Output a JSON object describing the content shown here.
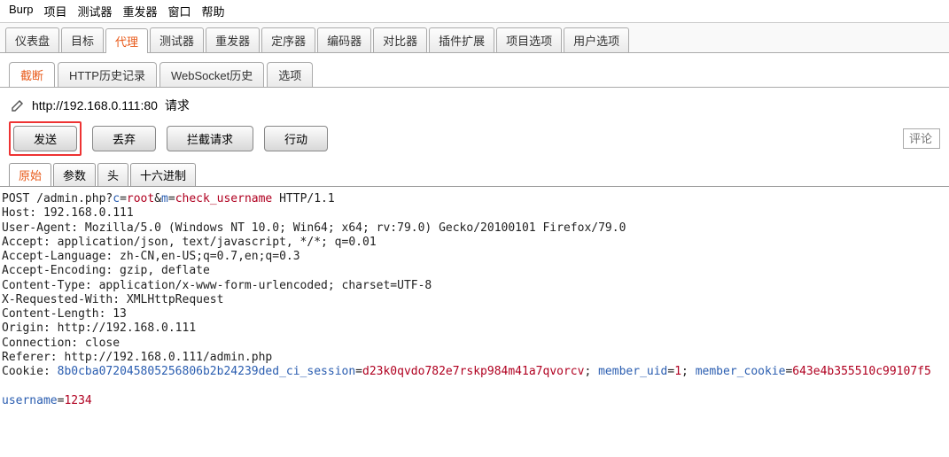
{
  "menubar": {
    "burp": "Burp",
    "project": "项目",
    "intruder": "测试器",
    "repeater": "重发器",
    "window": "窗口",
    "help": "帮助"
  },
  "main_tabs": {
    "dashboard": "仪表盘",
    "target": "目标",
    "proxy": "代理",
    "intruder": "测试器",
    "repeater": "重发器",
    "sequencer": "定序器",
    "decoder": "编码器",
    "comparer": "对比器",
    "extender": "插件扩展",
    "project_options": "项目选项",
    "user_options": "用户选项"
  },
  "sub_tabs": {
    "intercept": "截断",
    "http_history": "HTTP历史记录",
    "ws_history": "WebSocket历史",
    "options": "选项"
  },
  "request_line": {
    "url": "http://192.168.0.111:80",
    "label": "请求"
  },
  "buttons": {
    "forward": "发送",
    "drop": "丢弃",
    "intercept": "拦截请求",
    "action": "行动"
  },
  "comment_placeholder": "评论",
  "view_tabs": {
    "raw": "原始",
    "params": "参数",
    "headers": "头",
    "hex": "十六进制"
  },
  "raw_request": {
    "line1_pre": "POST /admin.php?",
    "line1_p1": "c",
    "line1_eq1": "=",
    "line1_v1": "root",
    "line1_amp": "&",
    "line1_p2": "m",
    "line1_eq2": "=",
    "line1_v2": "check_username",
    "line1_post": " HTTP/1.1",
    "host": "Host: 192.168.0.111",
    "ua": "User-Agent: Mozilla/5.0 (Windows NT 10.0; Win64; x64; rv:79.0) Gecko/20100101 Firefox/79.0",
    "accept": "Accept: application/json, text/javascript, */*; q=0.01",
    "accept_lang": "Accept-Language: zh-CN,en-US;q=0.7,en;q=0.3",
    "accept_enc": "Accept-Encoding: gzip, deflate",
    "ctype": "Content-Type: application/x-www-form-urlencoded; charset=UTF-8",
    "xreq": "X-Requested-With: XMLHttpRequest",
    "clen": "Content-Length: 13",
    "origin": "Origin: http://192.168.0.111",
    "conn": "Connection: close",
    "referer": "Referer: http://192.168.0.111/admin.php",
    "cookie_label": "Cookie: ",
    "cookie_k1": "8b0cba072045805256806b2b24239ded_ci_session",
    "cookie_eq": "=",
    "cookie_v1": "d23k0qvdo782e7rskp984m41a7qvorcv",
    "cookie_sep1": "; ",
    "cookie_k2": "member_uid",
    "cookie_v2": "1",
    "cookie_sep2": "; ",
    "cookie_k3": "member_cookie",
    "cookie_v3": "643e4b355510c99107f5",
    "body_k": "username",
    "body_eq": "=",
    "body_v": "1234"
  }
}
